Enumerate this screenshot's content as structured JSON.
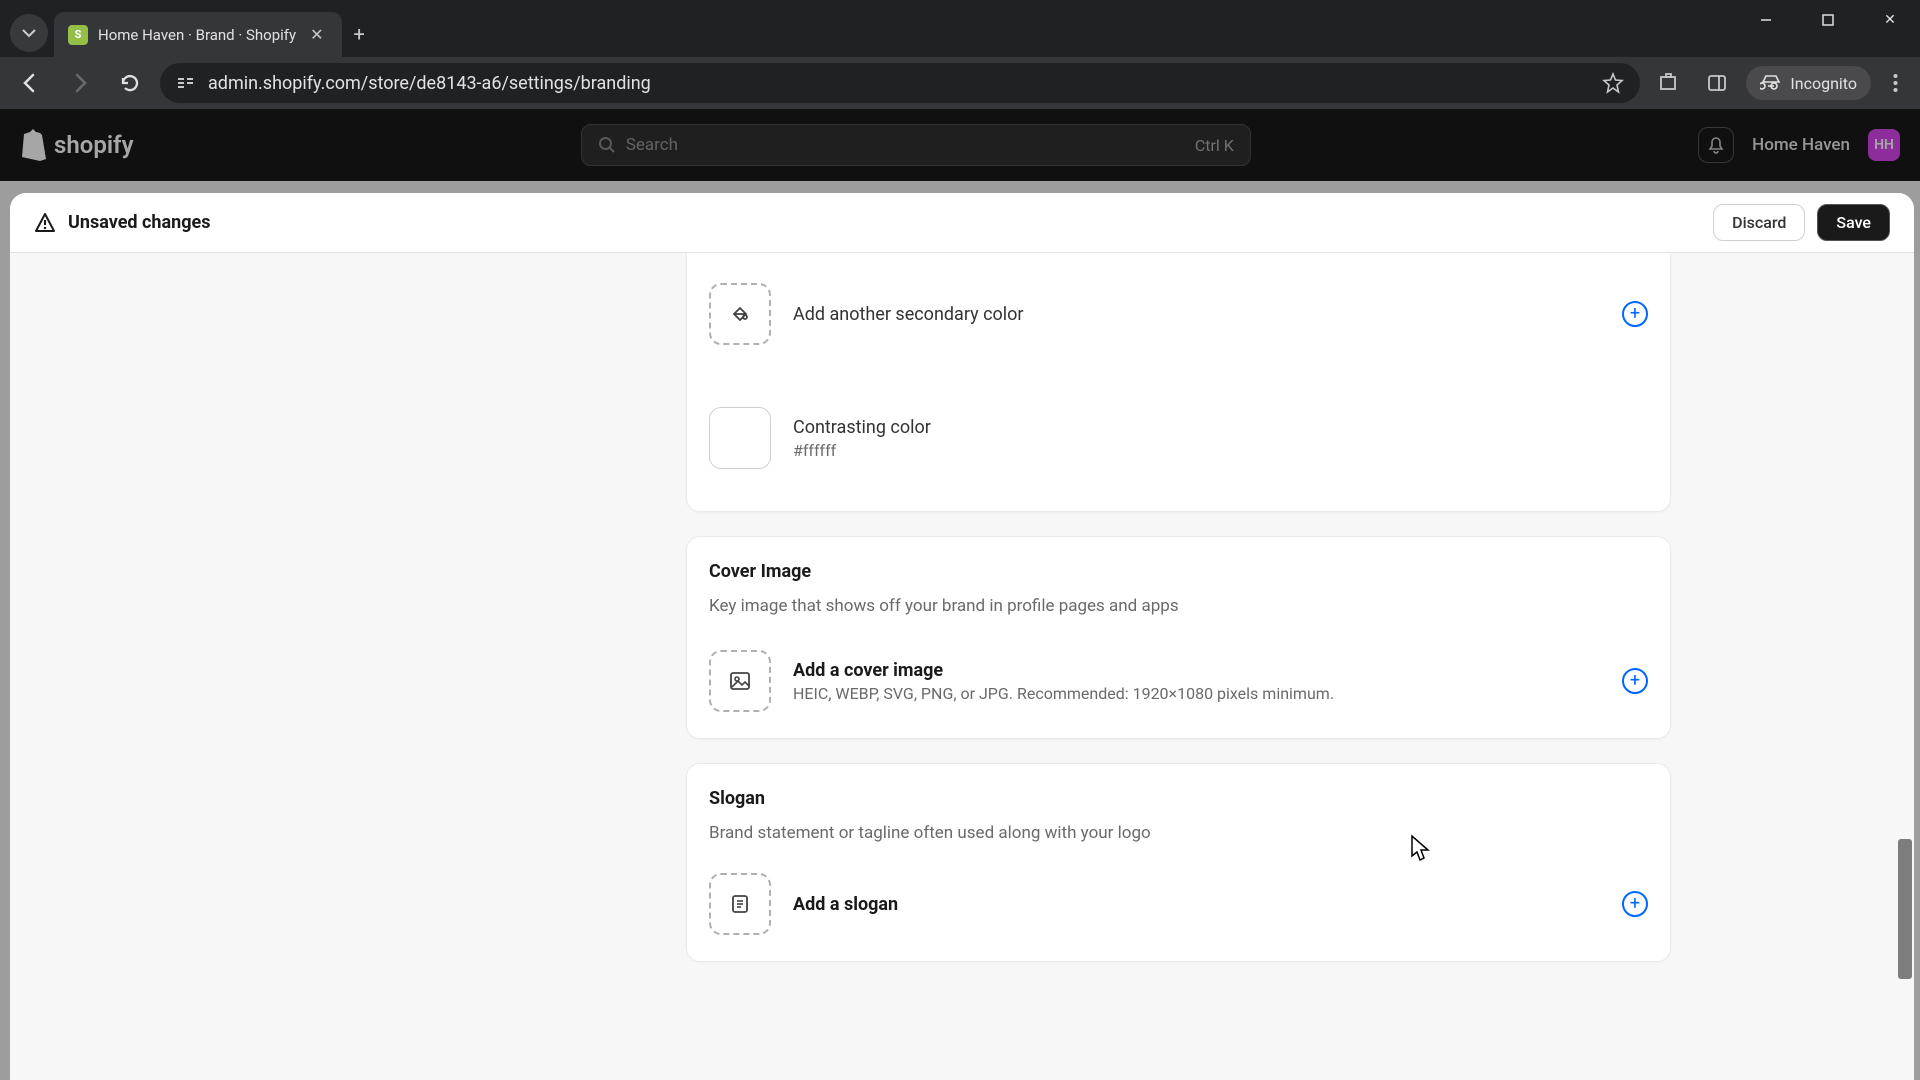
{
  "browser": {
    "tab_title": "Home Haven · Brand · Shopify",
    "url": "admin.shopify.com/store/de8143-a6/settings/branding",
    "incognito_label": "Incognito"
  },
  "topbar": {
    "search_placeholder": "Search",
    "search_shortcut": "Ctrl K",
    "store_name": "Home Haven",
    "avatar_initials": "HH"
  },
  "header": {
    "unsaved_label": "Unsaved changes",
    "discard_label": "Discard",
    "save_label": "Save"
  },
  "colors": {
    "add_secondary_label": "Add another secondary color",
    "contrasting_label": "Contrasting color",
    "contrasting_value": "#ffffff"
  },
  "cover": {
    "title": "Cover Image",
    "desc": "Key image that shows off your brand in profile pages and apps",
    "add_label": "Add a cover image",
    "add_hint": "HEIC, WEBP, SVG, PNG, or JPG. Recommended: 1920×1080 pixels minimum."
  },
  "slogan": {
    "title": "Slogan",
    "desc": "Brand statement or tagline often used along with your logo",
    "add_label": "Add a slogan"
  }
}
